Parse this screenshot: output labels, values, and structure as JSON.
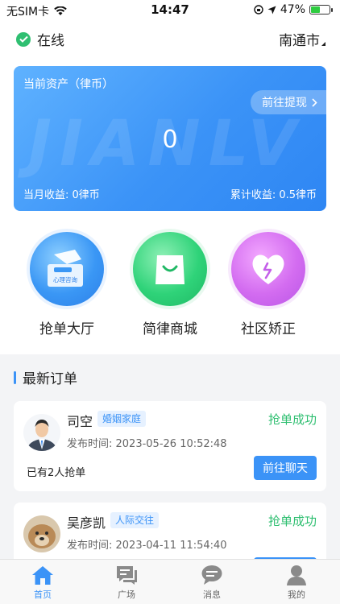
{
  "status_bar": {
    "carrier": "无SIM卡",
    "time": "14:47",
    "battery": "47%"
  },
  "header": {
    "online_label": "在线",
    "city": "南通市"
  },
  "asset_card": {
    "title": "当前资产（律币）",
    "watermark": "JIANLV",
    "withdraw_label": "前往提现",
    "balance": "0",
    "month_income": "当月收益: 0律币",
    "total_income": "累计收益: 0.5律币"
  },
  "features": [
    {
      "label": "抢单大厅",
      "icon_caption": "心理咨询",
      "icon": "consult-icon"
    },
    {
      "label": "简律商城",
      "icon": "shopping-bag-icon"
    },
    {
      "label": "社区矫正",
      "icon": "heart-icon"
    }
  ],
  "section": {
    "title": "最新订单"
  },
  "orders": [
    {
      "name": "司空",
      "tag": "婚姻家庭",
      "status": "抢单成功",
      "time": "发布时间: 2023-05-26 10:52:48",
      "count": "已有2人抢单",
      "action": "前往聊天"
    },
    {
      "name": "吴彦凯",
      "tag": "人际交往",
      "status": "抢单成功",
      "time": "发布时间: 2023-04-11 11:54:40"
    }
  ],
  "tabs": [
    {
      "label": "首页",
      "icon": "home-icon",
      "active": true
    },
    {
      "label": "广场",
      "icon": "square-chat-icon",
      "active": false
    },
    {
      "label": "消息",
      "icon": "message-icon",
      "active": false
    },
    {
      "label": "我的",
      "icon": "user-icon",
      "active": false
    }
  ],
  "colors": {
    "primary": "#3b93f7",
    "success": "#2fbf71",
    "background": "#f3f4f6"
  }
}
